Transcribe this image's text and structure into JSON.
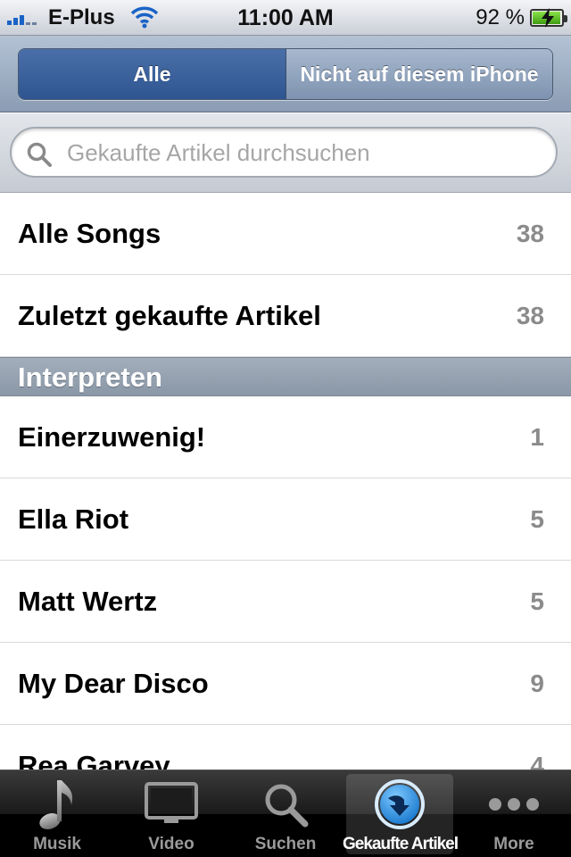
{
  "status_bar": {
    "carrier": "E-Plus",
    "time": "11:00 AM",
    "battery_percent": "92 %",
    "battery_level": 0.92,
    "icons": [
      "signal-icon",
      "wifi-icon",
      "battery-charging-icon"
    ]
  },
  "segmented_control": {
    "segments": [
      {
        "label": "Alle",
        "selected": true
      },
      {
        "label": "Nicht auf diesem iPhone",
        "selected": false
      }
    ]
  },
  "search": {
    "placeholder": "Gekaufte Artikel durchsuchen",
    "value": "",
    "icon": "search-icon"
  },
  "list": {
    "top_rows": [
      {
        "label": "Alle Songs",
        "count": "38"
      },
      {
        "label": "Zuletzt gekaufte Artikel",
        "count": "38"
      }
    ],
    "section": {
      "title": "Interpreten",
      "rows": [
        {
          "label": "Einerzuwenig!",
          "count": "1"
        },
        {
          "label": "Ella Riot",
          "count": "5"
        },
        {
          "label": "Matt Wertz",
          "count": "5"
        },
        {
          "label": "My Dear Disco",
          "count": "9"
        },
        {
          "label": "Rea Garvey",
          "count": "4"
        }
      ]
    }
  },
  "tab_bar": {
    "tabs": [
      {
        "label": "Musik",
        "icon": "music-note-icon",
        "selected": false
      },
      {
        "label": "Video",
        "icon": "tv-icon",
        "selected": false
      },
      {
        "label": "Suchen",
        "icon": "search-icon",
        "selected": false
      },
      {
        "label": "Gekaufte Artikel",
        "icon": "purchased-download-icon",
        "selected": true
      },
      {
        "label": "More",
        "icon": "more-dots-icon",
        "selected": false
      }
    ]
  },
  "colors": {
    "selected_segment": "#2f5591",
    "count_text": "#8b8b8b",
    "section_header": "#96a3b2",
    "tab_selected_icon": "#1e8fe8"
  }
}
